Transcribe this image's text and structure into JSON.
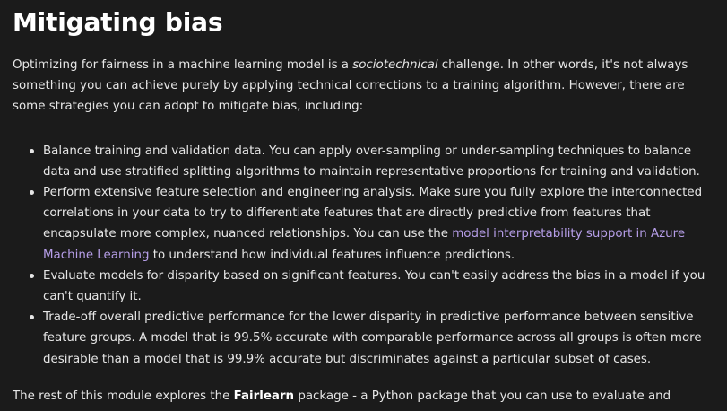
{
  "heading": "Mitigating bias",
  "intro": {
    "before_em": "Optimizing for fairness in a machine learning model is a ",
    "em": "sociotechnical",
    "after_em": " challenge. In other words, it's not always something you can achieve purely by applying technical corrections to a training algorithm. However, there are some strategies you can adopt to mitigate bias, including:"
  },
  "strategies": [
    {
      "text": "Balance training and validation data. You can apply over-sampling or under-sampling techniques to balance data and use stratified splitting algorithms to maintain representative proportions for training and validation."
    },
    {
      "before_link": "Perform extensive feature selection and engineering analysis. Make sure you fully explore the interconnected correlations in your data to try to differentiate features that are directly predictive from features that encapsulate more complex, nuanced relationships. You can use the ",
      "link_text": "model interpretability support in Azure Machine Learning",
      "after_link": " to understand how individual features influence predictions."
    },
    {
      "text": "Evaluate models for disparity based on significant features. You can't easily address the bias in a model if you can't quantify it."
    },
    {
      "text": "Trade-off overall predictive performance for the lower disparity in predictive performance between sensitive feature groups. A model that is 99.5% accurate with comparable performance across all groups is often more desirable than a model that is 99.9% accurate but discriminates against a particular subset of cases."
    }
  ],
  "outro": {
    "before_strong": "The rest of this module explores the ",
    "strong": "Fairlearn",
    "after_strong": " package - a Python package that you can use to evaluate and mitigate unfairness in machine learning models."
  },
  "colors": {
    "background": "#1b1b1b",
    "text": "#e6e6e6",
    "heading": "#ffffff",
    "link": "#b69ee8"
  }
}
